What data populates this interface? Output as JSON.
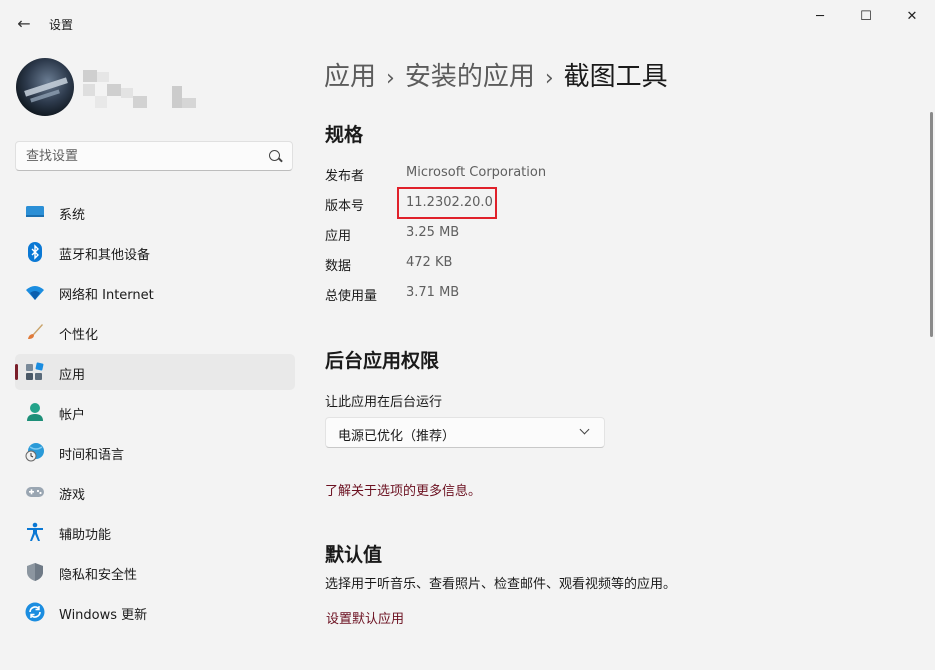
{
  "window": {
    "title": "设置",
    "back_glyph": "←",
    "minimize_glyph": "─",
    "maximize_glyph": "☐",
    "close_glyph": "✕"
  },
  "search": {
    "placeholder": "查找设置"
  },
  "nav": {
    "items": [
      {
        "label": "系统",
        "icon": "system-icon"
      },
      {
        "label": "蓝牙和其他设备",
        "icon": "bluetooth-icon"
      },
      {
        "label": "网络和 Internet",
        "icon": "wifi-icon"
      },
      {
        "label": "个性化",
        "icon": "brush-icon"
      },
      {
        "label": "应用",
        "icon": "apps-icon",
        "selected": true
      },
      {
        "label": "帐户",
        "icon": "account-icon"
      },
      {
        "label": "时间和语言",
        "icon": "time-language-icon"
      },
      {
        "label": "游戏",
        "icon": "gamepad-icon"
      },
      {
        "label": "辅助功能",
        "icon": "accessibility-icon"
      },
      {
        "label": "隐私和安全性",
        "icon": "shield-icon"
      },
      {
        "label": "Windows 更新",
        "icon": "update-icon"
      }
    ]
  },
  "breadcrumb": {
    "part1": "应用",
    "part2": "安装的应用",
    "current": "截图工具",
    "separator": "›"
  },
  "specs": {
    "title": "规格",
    "rows": [
      {
        "label": "发布者",
        "value": "Microsoft Corporation"
      },
      {
        "label": "版本号",
        "value": "11.2302.20.0"
      },
      {
        "label": "应用",
        "value": "3.25 MB"
      },
      {
        "label": "数据",
        "value": "472 KB"
      },
      {
        "label": "总使用量",
        "value": "3.71 MB"
      }
    ]
  },
  "background": {
    "title": "后台应用权限",
    "label": "让此应用在后台运行",
    "selected": "电源已优化（推荐）",
    "more_info_link": "了解关于选项的更多信息。"
  },
  "defaults": {
    "title": "默认值",
    "description": "选择用于听音乐、查看照片、检查邮件、观看视频等的应用。",
    "link": "设置默认应用"
  },
  "colors": {
    "accent": "#7a1e2a",
    "link": "#6b1020",
    "highlight": "#e0202a"
  }
}
